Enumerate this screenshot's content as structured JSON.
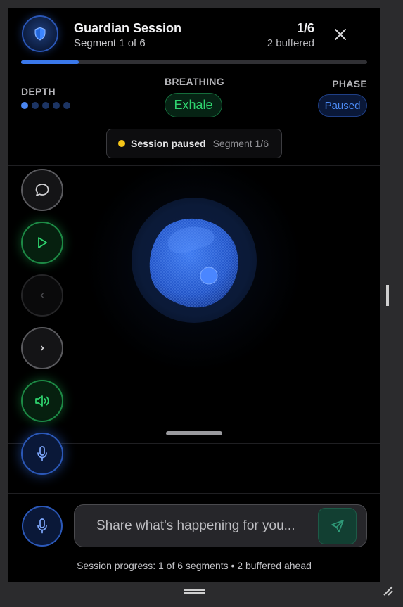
{
  "header": {
    "title": "Guardian Session",
    "subtitle": "Segment 1 of 6",
    "count": "1/6",
    "buffered": "2 buffered",
    "progress_fraction": 0.167
  },
  "meters": {
    "depth_label": "DEPTH",
    "depth_level": 1,
    "depth_max": 5,
    "breathing_label": "BREATHING",
    "breathing_value": "Exhale",
    "phase_label": "PHASE",
    "phase_value": "Paused"
  },
  "status": {
    "text": "Session paused",
    "segment": "Segment 1/6",
    "dot_color": "#f5c518"
  },
  "controls": [
    {
      "name": "chat-button",
      "icon": "chat-bubble-icon"
    },
    {
      "name": "play-button",
      "icon": "play-icon"
    },
    {
      "name": "previous-button",
      "icon": "chevron-left-icon"
    },
    {
      "name": "next-button",
      "icon": "chevron-right-icon"
    },
    {
      "name": "volume-button",
      "icon": "speaker-icon"
    },
    {
      "name": "voice-button",
      "icon": "microphone-icon"
    }
  ],
  "composer": {
    "placeholder": "Share what's happening for you...",
    "mic_icon": "microphone-icon",
    "send_icon": "send-icon"
  },
  "footer": {
    "text": "Session progress: 1 of 6 segments • 2 buffered ahead"
  },
  "colors": {
    "accent_blue": "#3a78ea",
    "accent_green": "#2fd46e",
    "background": "#000000"
  }
}
